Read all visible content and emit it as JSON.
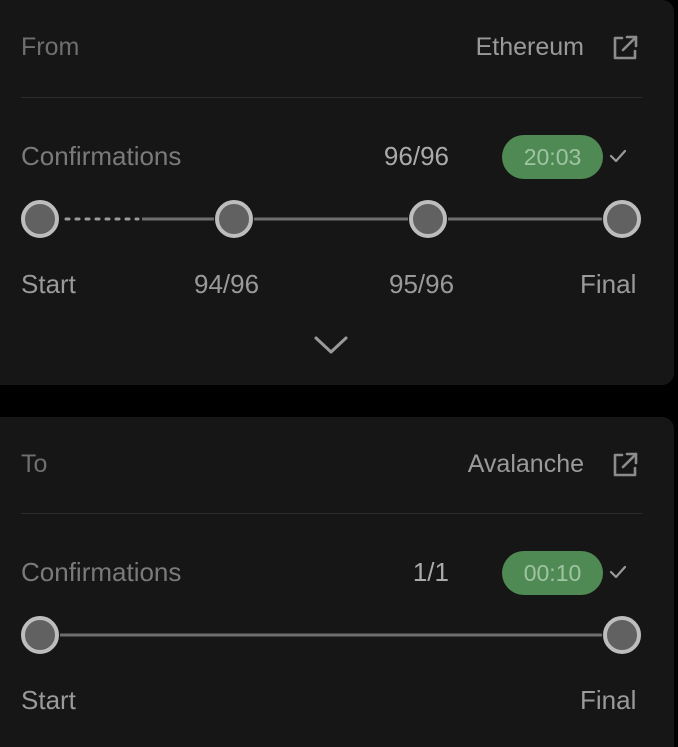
{
  "from_card": {
    "label": "From",
    "chain": "Ethereum",
    "confirmations_label": "Confirmations",
    "confirmations_count": "96/96",
    "time": "20:03",
    "steps": [
      "Start",
      "94/96",
      "95/96",
      "Final"
    ]
  },
  "to_card": {
    "label": "To",
    "chain": "Avalanche",
    "confirmations_label": "Confirmations",
    "confirmations_count": "1/1",
    "time": "00:10",
    "steps": [
      "Start",
      "Final"
    ]
  },
  "colors": {
    "background": "#000000",
    "card": "#161616",
    "badge": "#4f8a55",
    "badge_text": "#9ec4a1",
    "node_fill": "#616161",
    "node_ring": "#bdbdbd",
    "track_line": "#6e6e6e"
  },
  "icons": {
    "external_link": "external-link-icon",
    "check": "check-icon",
    "expand": "chevron-down-icon"
  }
}
